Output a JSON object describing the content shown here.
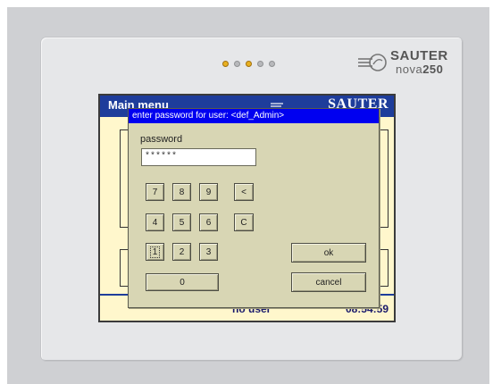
{
  "device": {
    "brand": "SAUTER",
    "model_prefix": "nova",
    "model_number": "250",
    "leds": [
      {
        "state": "on"
      },
      {
        "state": "off"
      },
      {
        "state": "on"
      },
      {
        "state": "off"
      },
      {
        "state": "off"
      }
    ]
  },
  "screen": {
    "title": "Main menu",
    "logo": "SAUTER",
    "status_user": "no user",
    "status_time": "08:54:59"
  },
  "dialog": {
    "title": "enter password for user:  <def_Admin>",
    "password_label": "password",
    "password_value": "******",
    "keys": {
      "k7": "7",
      "k8": "8",
      "k9": "9",
      "back": "<",
      "k4": "4",
      "k5": "5",
      "k6": "6",
      "clear": "C",
      "k1": "1",
      "k2": "2",
      "k3": "3",
      "k0": "0",
      "ok": "ok",
      "cancel": "cancel"
    }
  },
  "colors": {
    "title_bar": "#1e3d9b",
    "dialog_title": "#0000f0",
    "dialog_bg": "#d8d6b4",
    "screen_bg": "#fff7cc",
    "led_on": "#e8b020"
  }
}
